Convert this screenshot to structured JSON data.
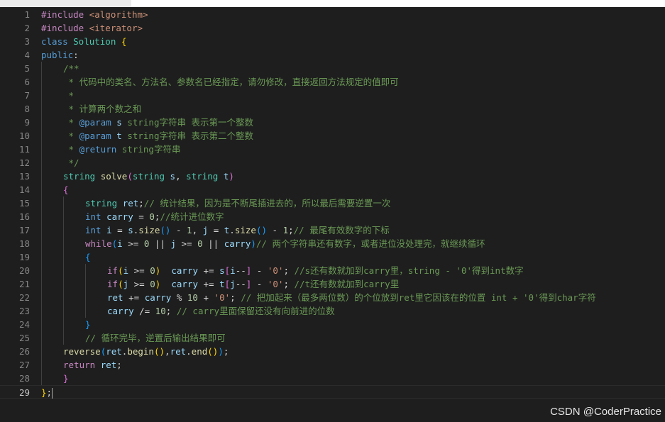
{
  "watermark": "CSDN @CoderPractice",
  "current_line": 29,
  "lines": [
    {
      "n": "1",
      "indent": 0,
      "toks": [
        [
          "t-ctl",
          "#include "
        ],
        [
          "t-inc",
          "<algorithm>"
        ]
      ]
    },
    {
      "n": "2",
      "indent": 0,
      "toks": [
        [
          "t-ctl",
          "#include "
        ],
        [
          "t-inc",
          "<iterator>"
        ]
      ]
    },
    {
      "n": "3",
      "indent": 0,
      "toks": [
        [
          "t-kw",
          "class "
        ],
        [
          "t-typ",
          "Solution "
        ],
        [
          "b1",
          "{"
        ]
      ]
    },
    {
      "n": "4",
      "indent": 0,
      "toks": [
        [
          "t-kw",
          "public"
        ],
        [
          "t-op",
          ":"
        ]
      ]
    },
    {
      "n": "5",
      "indent": 1,
      "toks": [
        [
          "t-cmt",
          "/**"
        ]
      ]
    },
    {
      "n": "6",
      "indent": 1,
      "toks": [
        [
          "t-cmt",
          " * 代码中的类名、方法名、参数名已经指定，请勿修改，直接返回方法规定的值即可"
        ]
      ]
    },
    {
      "n": "7",
      "indent": 1,
      "toks": [
        [
          "t-cmt",
          " *"
        ]
      ]
    },
    {
      "n": "8",
      "indent": 1,
      "toks": [
        [
          "t-cmt",
          " * 计算两个数之和"
        ]
      ]
    },
    {
      "n": "9",
      "indent": 1,
      "toks": [
        [
          "t-cmt",
          " * "
        ],
        [
          "t-kw",
          "@param "
        ],
        [
          "t-var",
          "s "
        ],
        [
          "t-cmt",
          "string字符串 表示第一个整数"
        ]
      ]
    },
    {
      "n": "10",
      "indent": 1,
      "toks": [
        [
          "t-cmt",
          " * "
        ],
        [
          "t-kw",
          "@param "
        ],
        [
          "t-var",
          "t "
        ],
        [
          "t-cmt",
          "string字符串 表示第二个整数"
        ]
      ]
    },
    {
      "n": "11",
      "indent": 1,
      "toks": [
        [
          "t-cmt",
          " * "
        ],
        [
          "t-kw",
          "@return "
        ],
        [
          "t-cmt",
          "string字符串"
        ]
      ]
    },
    {
      "n": "12",
      "indent": 1,
      "toks": [
        [
          "t-cmt",
          " */"
        ]
      ]
    },
    {
      "n": "13",
      "indent": 1,
      "toks": [
        [
          "t-typ",
          "string "
        ],
        [
          "t-fn",
          "solve"
        ],
        [
          "b2",
          "("
        ],
        [
          "t-typ",
          "string "
        ],
        [
          "t-var",
          "s"
        ],
        [
          "t-op",
          ", "
        ],
        [
          "t-typ",
          "string "
        ],
        [
          "t-var",
          "t"
        ],
        [
          "b2",
          ")"
        ]
      ]
    },
    {
      "n": "14",
      "indent": 1,
      "toks": [
        [
          "b2",
          "{"
        ]
      ]
    },
    {
      "n": "15",
      "indent": 2,
      "toks": [
        [
          "t-typ",
          "string "
        ],
        [
          "t-var",
          "ret"
        ],
        [
          "t-op",
          ";"
        ],
        [
          "t-cmt",
          "// 统计结果，因为是不断尾插进去的，所以最后需要逆置一次"
        ]
      ]
    },
    {
      "n": "16",
      "indent": 2,
      "toks": [
        [
          "t-kw",
          "int "
        ],
        [
          "t-var",
          "carry "
        ],
        [
          "t-op",
          "= "
        ],
        [
          "t-num",
          "0"
        ],
        [
          "t-op",
          ";"
        ],
        [
          "t-cmt",
          "//统计进位数字"
        ]
      ]
    },
    {
      "n": "17",
      "indent": 2,
      "toks": [
        [
          "t-kw",
          "int "
        ],
        [
          "t-var",
          "i "
        ],
        [
          "t-op",
          "= "
        ],
        [
          "t-var",
          "s"
        ],
        [
          "t-op",
          "."
        ],
        [
          "t-fn",
          "size"
        ],
        [
          "b3",
          "()"
        ],
        [
          "t-op",
          " - "
        ],
        [
          "t-num",
          "1"
        ],
        [
          "t-op",
          ", "
        ],
        [
          "t-var",
          "j "
        ],
        [
          "t-op",
          "= "
        ],
        [
          "t-var",
          "t"
        ],
        [
          "t-op",
          "."
        ],
        [
          "t-fn",
          "size"
        ],
        [
          "b3",
          "()"
        ],
        [
          "t-op",
          " - "
        ],
        [
          "t-num",
          "1"
        ],
        [
          "t-op",
          ";"
        ],
        [
          "t-cmt",
          "// 最尾有效数字的下标"
        ]
      ]
    },
    {
      "n": "18",
      "indent": 2,
      "toks": [
        [
          "t-ctl",
          "while"
        ],
        [
          "b3",
          "("
        ],
        [
          "t-var",
          "i "
        ],
        [
          "t-op",
          ">= "
        ],
        [
          "t-num",
          "0 "
        ],
        [
          "t-op",
          "|| "
        ],
        [
          "t-var",
          "j "
        ],
        [
          "t-op",
          ">= "
        ],
        [
          "t-num",
          "0 "
        ],
        [
          "t-op",
          "|| "
        ],
        [
          "t-var",
          "carry"
        ],
        [
          "b3",
          ")"
        ],
        [
          "t-cmt",
          "// 两个字符串还有数字，或者进位没处理完，就继续循环"
        ]
      ]
    },
    {
      "n": "19",
      "indent": 2,
      "toks": [
        [
          "b3",
          "{"
        ]
      ]
    },
    {
      "n": "20",
      "indent": 3,
      "toks": [
        [
          "t-ctl",
          "if"
        ],
        [
          "b1",
          "("
        ],
        [
          "t-var",
          "i "
        ],
        [
          "t-op",
          ">= "
        ],
        [
          "t-num",
          "0"
        ],
        [
          "b1",
          ")"
        ],
        [
          "t-op",
          "  "
        ],
        [
          "t-var",
          "carry "
        ],
        [
          "t-op",
          "+= "
        ],
        [
          "t-var",
          "s"
        ],
        [
          "b2",
          "["
        ],
        [
          "t-var",
          "i"
        ],
        [
          "t-op",
          "--"
        ],
        [
          "b2",
          "]"
        ],
        [
          "t-op",
          " - "
        ],
        [
          "t-str",
          "'0'"
        ],
        [
          "t-op",
          "; "
        ],
        [
          "t-cmt",
          "//s还有数就加到carry里，string - '0'得到int数字"
        ]
      ]
    },
    {
      "n": "21",
      "indent": 3,
      "toks": [
        [
          "t-ctl",
          "if"
        ],
        [
          "b1",
          "("
        ],
        [
          "t-var",
          "j "
        ],
        [
          "t-op",
          ">= "
        ],
        [
          "t-num",
          "0"
        ],
        [
          "b1",
          ")"
        ],
        [
          "t-op",
          "  "
        ],
        [
          "t-var",
          "carry "
        ],
        [
          "t-op",
          "+= "
        ],
        [
          "t-var",
          "t"
        ],
        [
          "b2",
          "["
        ],
        [
          "t-var",
          "j"
        ],
        [
          "t-op",
          "--"
        ],
        [
          "b2",
          "]"
        ],
        [
          "t-op",
          " - "
        ],
        [
          "t-str",
          "'0'"
        ],
        [
          "t-op",
          "; "
        ],
        [
          "t-cmt",
          "//t还有数就加到carry里"
        ]
      ]
    },
    {
      "n": "22",
      "indent": 3,
      "toks": [
        [
          "t-var",
          "ret "
        ],
        [
          "t-op",
          "+= "
        ],
        [
          "t-var",
          "carry "
        ],
        [
          "t-op",
          "% "
        ],
        [
          "t-num",
          "10 "
        ],
        [
          "t-op",
          "+ "
        ],
        [
          "t-str",
          "'0'"
        ],
        [
          "t-op",
          "; "
        ],
        [
          "t-cmt",
          "// 把加起来（最多两位数）的个位放到ret里它因该在的位置 int + '0'得到char字符"
        ]
      ]
    },
    {
      "n": "23",
      "indent": 3,
      "toks": [
        [
          "t-var",
          "carry "
        ],
        [
          "t-op",
          "/= "
        ],
        [
          "t-num",
          "10"
        ],
        [
          "t-op",
          "; "
        ],
        [
          "t-cmt",
          "// carry里面保留还没有向前进的位数"
        ]
      ]
    },
    {
      "n": "24",
      "indent": 2,
      "toks": [
        [
          "b3",
          "}"
        ]
      ]
    },
    {
      "n": "25",
      "indent": 2,
      "toks": [
        [
          "t-cmt",
          "// 循环完毕，逆置后输出结果即可"
        ]
      ]
    },
    {
      "n": "26",
      "indent": 1,
      "toks": [
        [
          "t-fn",
          "reverse"
        ],
        [
          "b3",
          "("
        ],
        [
          "t-var",
          "ret"
        ],
        [
          "t-op",
          "."
        ],
        [
          "t-fn",
          "begin"
        ],
        [
          "b1",
          "()"
        ],
        [
          "t-op",
          ","
        ],
        [
          "t-var",
          "ret"
        ],
        [
          "t-op",
          "."
        ],
        [
          "t-fn",
          "end"
        ],
        [
          "b1",
          "()"
        ],
        [
          "b3",
          ")"
        ],
        [
          "t-op",
          ";"
        ]
      ]
    },
    {
      "n": "27",
      "indent": 1,
      "toks": [
        [
          "t-ctl",
          "return "
        ],
        [
          "t-var",
          "ret"
        ],
        [
          "t-op",
          ";"
        ]
      ]
    },
    {
      "n": "28",
      "indent": 1,
      "toks": [
        [
          "b2",
          "}"
        ]
      ]
    },
    {
      "n": "29",
      "indent": 0,
      "toks": [
        [
          "b1",
          "}"
        ],
        [
          "t-op",
          ";"
        ]
      ]
    }
  ]
}
